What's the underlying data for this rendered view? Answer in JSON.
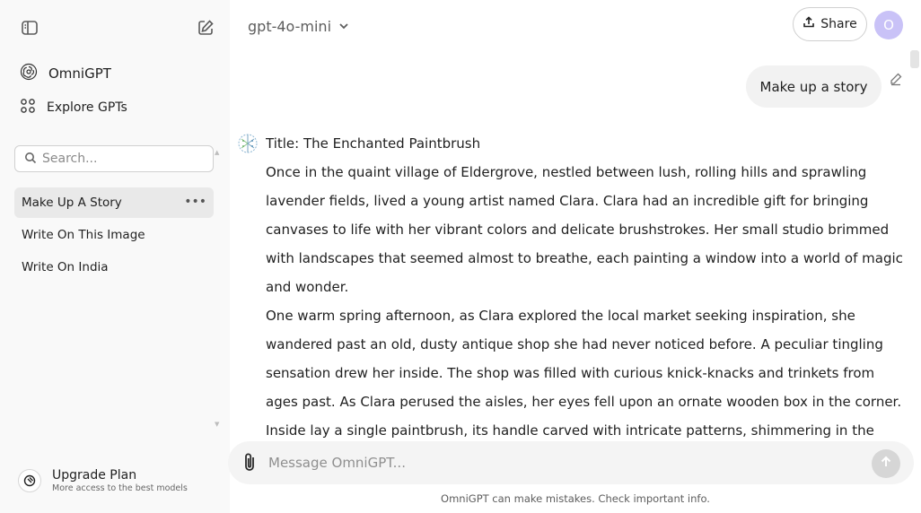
{
  "sidebar": {
    "brand": {
      "label": "OmniGPT",
      "icon": "omnigpt-logo-icon"
    },
    "explore": {
      "label": "Explore GPTs",
      "icon": "grid-icon"
    },
    "search": {
      "placeholder": "Search..."
    },
    "history": [
      {
        "label": "Make Up A Story",
        "active": true,
        "menu": "•••"
      },
      {
        "label": "Write On This Image",
        "active": false
      },
      {
        "label": "Write On India",
        "active": false
      }
    ],
    "upgrade": {
      "title": "Upgrade Plan",
      "subtitle": "More access to the best models"
    }
  },
  "header": {
    "model": "gpt-4o-mini",
    "share_label": "Share",
    "avatar_initial": "O"
  },
  "conversation": {
    "user_message": "Make up a story",
    "assistant_paragraphs": [
      "Title: The Enchanted Paintbrush",
      "Once in the quaint village of Eldergrove, nestled between lush, rolling hills and sprawling lavender fields, lived a young artist named Clara. Clara had an incredible gift for bringing canvases to life with her vibrant colors and delicate brushstrokes. Her small studio brimmed with landscapes that seemed almost to breathe, each painting a window into a world of magic and wonder.",
      "One warm spring afternoon, as Clara explored the local market seeking inspiration, she wandered past an old, dusty antique shop she had never noticed before. A peculiar tingling sensation drew her inside. The shop was filled with curious knick-knacks and trinkets from ages past. As Clara perused the aisles, her eyes fell upon an ornate wooden box in the corner. Inside lay a single paintbrush, its handle carved with intricate patterns, shimmering in the sunlight."
    ]
  },
  "composer": {
    "placeholder": "Message OmniGPT...",
    "disclaimer": "OmniGPT can make mistakes. Check important info."
  },
  "colors": {
    "sidebar_bg": "#f9f9f9",
    "active_item_bg": "#e9e9e9",
    "avatar_bg": "#c9c2f7",
    "user_bubble_bg": "#f2f2f2",
    "composer_bg": "#f4f4f4"
  }
}
